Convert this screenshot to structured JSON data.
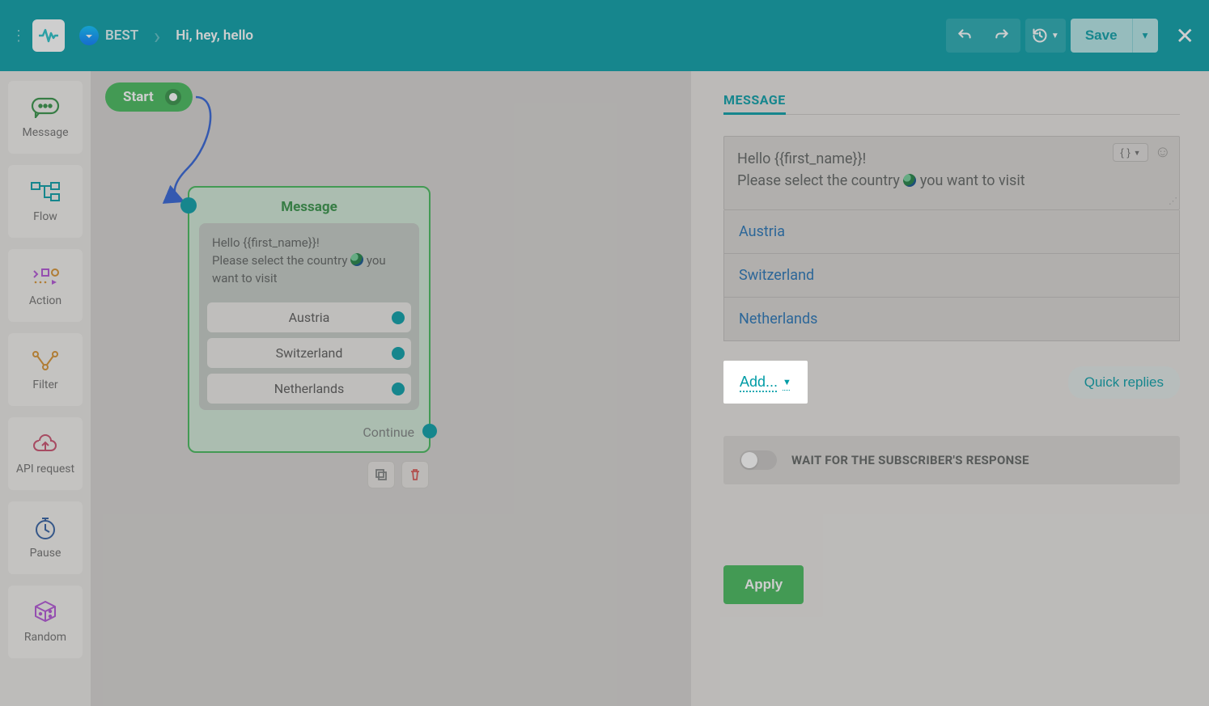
{
  "header": {
    "bot_name": "BEST",
    "flow_title": "Hi, hey, hello",
    "save_label": "Save"
  },
  "sidebar": {
    "items": [
      {
        "label": "Message"
      },
      {
        "label": "Flow"
      },
      {
        "label": "Action"
      },
      {
        "label": "Filter"
      },
      {
        "label": "API request"
      },
      {
        "label": "Pause"
      },
      {
        "label": "Random"
      }
    ]
  },
  "canvas": {
    "start_label": "Start",
    "node": {
      "title": "Message",
      "text_line1": "Hello  {{first_name}}!",
      "text_line2a": "Please select the country ",
      "text_line2b": " you want to visit",
      "options": [
        "Austria",
        "Switzerland",
        "Netherlands"
      ],
      "continue_label": "Continue"
    }
  },
  "panel": {
    "title": "MESSAGE",
    "msg_line1": "Hello  {{first_name}}!",
    "msg_line2a": "Please select the country ",
    "msg_line2b": " you want to visit",
    "var_btn": "{ }",
    "options": [
      "Austria",
      "Switzerland",
      "Netherlands"
    ],
    "add_label": "Add...",
    "quick_replies_label": "Quick replies",
    "wait_label": "WAIT FOR THE SUBSCRIBER'S RESPONSE",
    "apply_label": "Apply"
  }
}
